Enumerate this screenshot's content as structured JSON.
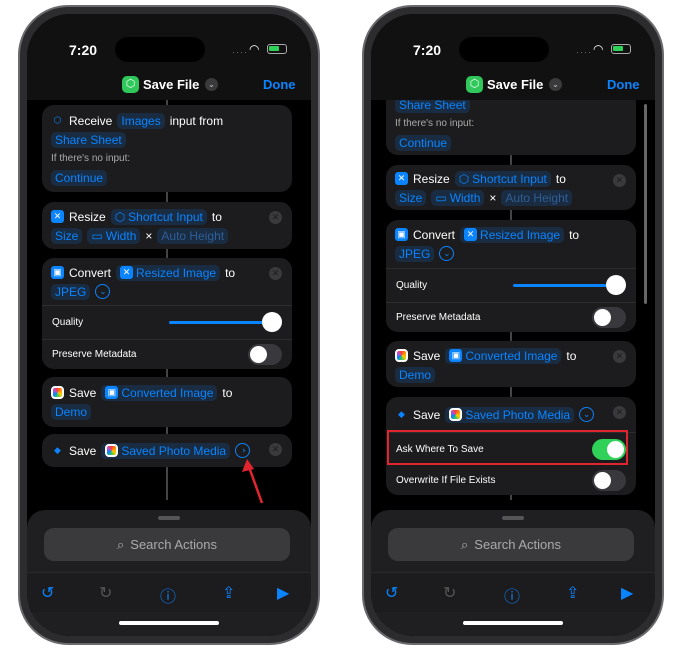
{
  "screens": [
    {
      "time": "7:20",
      "title": "Save File",
      "done": "Done",
      "receive": {
        "verb": "Receive",
        "type": "Images",
        "text": "input from",
        "source": "Share Sheet",
        "no_input_label": "If there's no input:",
        "no_input_action": "Continue"
      },
      "resize": {
        "verb": "Resize",
        "input": "Shortcut Input",
        "to": "to",
        "mode": "Size",
        "width": "Width",
        "times": "×",
        "height": "Auto Height"
      },
      "convert": {
        "verb": "Convert",
        "input": "Resized Image",
        "to": "to",
        "format": "JPEG",
        "quality_label": "Quality",
        "quality": 1.0,
        "preserve_label": "Preserve Metadata",
        "preserve": false
      },
      "save1": {
        "verb": "Save",
        "input": "Converted Image",
        "to": "to",
        "album": "Demo"
      },
      "save2": {
        "verb": "Save",
        "input": "Saved Photo Media",
        "expanded": false
      },
      "search_placeholder": "Search Actions"
    },
    {
      "time": "7:20",
      "title": "Save File",
      "done": "Done",
      "receive": {
        "source": "Share Sheet",
        "no_input_label": "If there's no input:",
        "no_input_action": "Continue"
      },
      "resize": {
        "verb": "Resize",
        "input": "Shortcut Input",
        "to": "to",
        "mode": "Size",
        "width": "Width",
        "times": "×",
        "height": "Auto Height"
      },
      "convert": {
        "verb": "Convert",
        "input": "Resized Image",
        "to": "to",
        "format": "JPEG",
        "quality_label": "Quality",
        "quality": 1.0,
        "preserve_label": "Preserve Metadata",
        "preserve": false
      },
      "save1": {
        "verb": "Save",
        "input": "Converted Image",
        "to": "to",
        "album": "Demo"
      },
      "save2": {
        "verb": "Save",
        "input": "Saved Photo Media",
        "expanded": true,
        "ask_label": "Ask Where To Save",
        "ask": true,
        "overwrite_label": "Overwrite If File Exists",
        "overwrite": false
      },
      "search_placeholder": "Search Actions"
    }
  ],
  "colors": {
    "accent": "#0a84ff",
    "toggle_on": "#30d158",
    "highlight": "#e0252f"
  }
}
